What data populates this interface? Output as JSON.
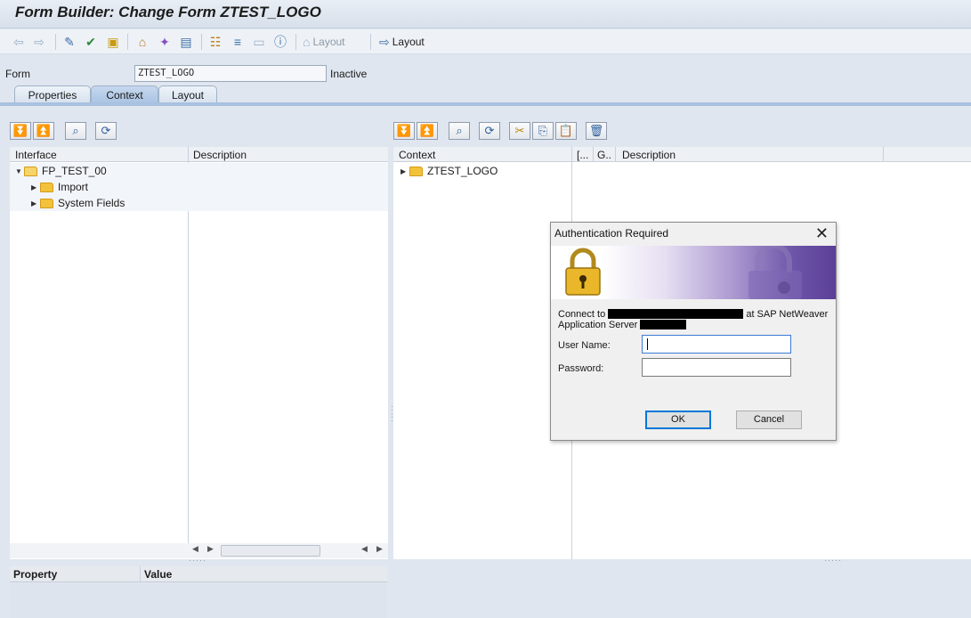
{
  "window": {
    "title": "Form Builder: Change Form ZTEST_LOGO"
  },
  "toolbar": {
    "back_icon": "arrow-left-icon",
    "forward_icon": "arrow-right-icon",
    "layout_disabled_label": "Layout",
    "layout_label": "Layout"
  },
  "form": {
    "label": "Form",
    "value": "ZTEST_LOGO",
    "status": "Inactive"
  },
  "tabs": [
    {
      "label": "Properties",
      "active": false
    },
    {
      "label": "Context",
      "active": true
    },
    {
      "label": "Layout",
      "active": false
    }
  ],
  "interface_panel": {
    "col_interface": "Interface",
    "col_description": "Description",
    "tree": [
      {
        "label": "FP_TEST_00",
        "expanded": true,
        "level": 0
      },
      {
        "label": "Import",
        "expanded": false,
        "level": 1
      },
      {
        "label": "System Fields",
        "expanded": false,
        "level": 1
      }
    ]
  },
  "context_panel": {
    "col_context": "Context",
    "col_short1": "[...",
    "col_short2": "G..",
    "col_description": "Description",
    "tree": [
      {
        "label": "ZTEST_LOGO",
        "expanded": false,
        "level": 0
      }
    ]
  },
  "properties": {
    "col_property": "Property",
    "col_value": "Value"
  },
  "dialog": {
    "title": "Authentication Required",
    "connect_prefix": "Connect to",
    "connect_middle": "at SAP NetWeaver",
    "connect_line2": "Application Server",
    "username_label": "User Name:",
    "username_value": "",
    "password_label": "Password:",
    "password_value": "",
    "ok_label": "OK",
    "cancel_label": "Cancel"
  }
}
